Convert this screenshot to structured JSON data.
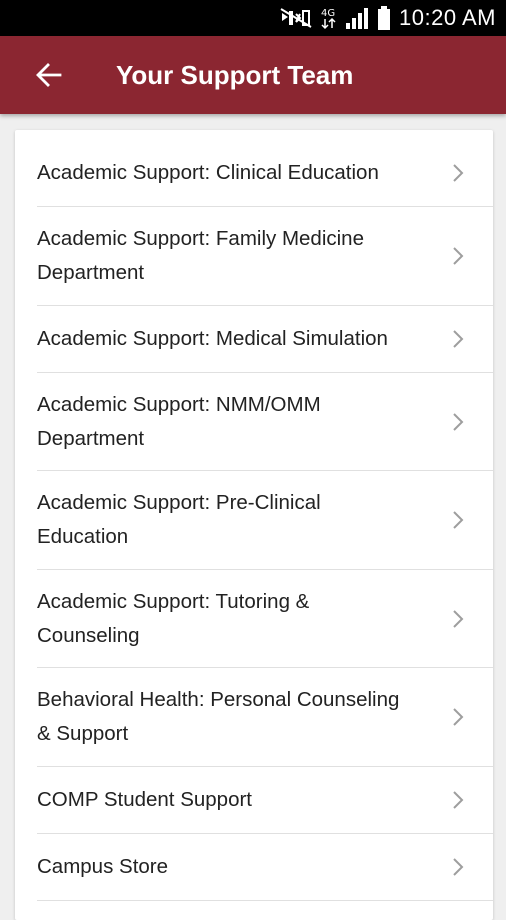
{
  "status_bar": {
    "time": "10:20 AM",
    "icons": [
      "mute-icon",
      "data-4g-icon",
      "signal-icon",
      "battery-icon"
    ]
  },
  "app_bar": {
    "title": "Your Support Team",
    "back_icon": "arrow-left-icon",
    "color": "#8b2631"
  },
  "support_list": {
    "chevron_icon": "chevron-right-icon",
    "items": [
      {
        "label": "Academic Support: Clinical Education"
      },
      {
        "label": "Academic Support: Family Medicine Department"
      },
      {
        "label": "Academic Support: Medical Simulation"
      },
      {
        "label": "Academic Support: NMM/OMM Department"
      },
      {
        "label": "Academic Support: Pre-Clinical Education"
      },
      {
        "label": "Academic Support: Tutoring & Counseling"
      },
      {
        "label": "Behavioral Health: Personal Counseling & Support"
      },
      {
        "label": "COMP Student Support"
      },
      {
        "label": "Campus Store"
      }
    ]
  }
}
